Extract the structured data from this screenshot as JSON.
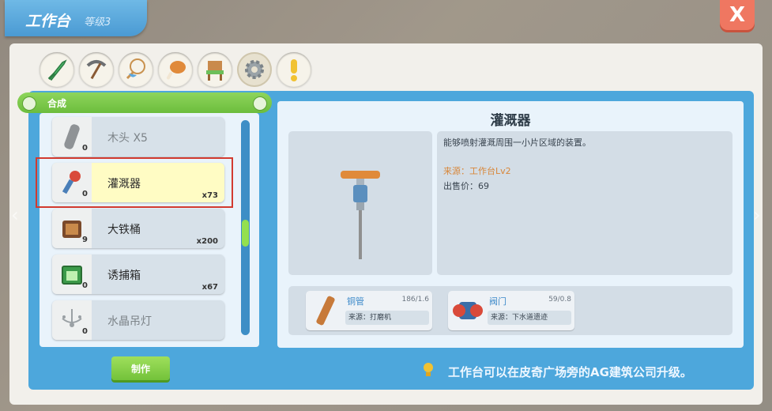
{
  "window": {
    "title": "工作台",
    "level": "等级3",
    "close_label": "X"
  },
  "categories": [
    {
      "icon": "sword-icon"
    },
    {
      "icon": "pickaxe-icon"
    },
    {
      "icon": "fishing-net-icon"
    },
    {
      "icon": "drumstick-icon"
    },
    {
      "icon": "chair-icon"
    },
    {
      "icon": "gear-icon",
      "active": true
    },
    {
      "icon": "exclamation-icon"
    }
  ],
  "list": {
    "header": "合成",
    "items": [
      {
        "name": "木头 X5",
        "count": "0",
        "qty": "",
        "locked": true,
        "icon": "wood-icon"
      },
      {
        "name": "灌溉器",
        "count": "0",
        "qty": "x73",
        "selected": true,
        "icon": "sprinkler-icon"
      },
      {
        "name": "大铁桶",
        "count": "9",
        "qty": "x200",
        "icon": "barrel-icon"
      },
      {
        "name": "诱捕箱",
        "count": "0",
        "qty": "x67",
        "icon": "trap-box-icon"
      },
      {
        "name": "水晶吊灯",
        "count": "0",
        "qty": "",
        "locked": true,
        "icon": "chandelier-icon"
      }
    ]
  },
  "craft_button": "制作",
  "detail": {
    "title": "灌溉器",
    "description": "能够喷射灌溉周围一小片区域的装置。",
    "source": "来源：工作台Lv2",
    "price": "出售价：69",
    "materials": [
      {
        "name": "铜管",
        "count": "186/1.6",
        "source": "来源：打磨机",
        "icon": "copper-pipe-icon"
      },
      {
        "name": "阀门",
        "count": "59/0.8",
        "source": "来源：下水道遗迹",
        "icon": "valve-icon"
      }
    ]
  },
  "hint": "工作台可以在皮奇广场旁的AG建筑公司升级。"
}
